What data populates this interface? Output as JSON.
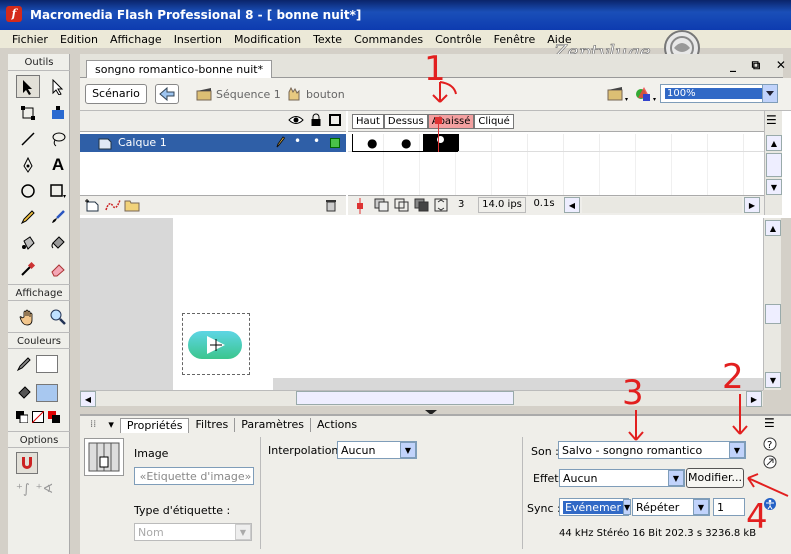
{
  "app": {
    "title": "Macromedia Flash Professional 8 - [ bonne nuit*]",
    "icon_letter": "f"
  },
  "menu": [
    "Fichier",
    "Edition",
    "Affichage",
    "Insertion",
    "Modification",
    "Texte",
    "Commandes",
    "Contrôle",
    "Fenêtre",
    "Aide"
  ],
  "watermark": {
    "text": "Zeptyluge"
  },
  "tools": {
    "outils_label": "Outils",
    "affichage_label": "Affichage",
    "couleurs_label": "Couleurs",
    "options_label": "Options",
    "text_tool_glyph": "A"
  },
  "document": {
    "tab_label": "songno romantico-bonne nuit*",
    "scene_button": "Scénario",
    "breadcrumb_scene": "Séquence 1",
    "breadcrumb_symbol": "bouton",
    "zoom": "100%",
    "window_buttons": [
      "_",
      "⧉",
      "✕"
    ]
  },
  "timeline": {
    "layer_name": "Calque 1",
    "frame_labels": [
      "Haut",
      "Dessus",
      "Abaissé",
      "Cliqué"
    ],
    "selected_frame_label": "Abaissé",
    "current_frame": "3",
    "frame_rate": "14.0 ips",
    "elapsed_time": "0.1s"
  },
  "properties": {
    "tabs": [
      "Propriétés",
      "Filtres",
      "Paramètres",
      "Actions"
    ],
    "active_tab": "Propriétés",
    "type_label": "Image",
    "frame_label_placeholder": "«Etiquette d'image»",
    "label_type_label": "Type d'étiquette :",
    "label_type_value": "Nom",
    "interpolation_label": "Interpolation:",
    "interpolation_value": "Aucun",
    "sound_label": "Son :",
    "sound_value": "Salvo - songno romantico",
    "effect_label": "Effet",
    "effect_value": "Aucun",
    "modify_button": "Modifier...",
    "sync_label": "Sync :",
    "sync_value": "Evénemer",
    "repeat_value": "Répéter",
    "repeat_count": "1",
    "sound_info": "44 kHz Stéréo 16 Bit 202.3 s 3236.8 kB"
  },
  "annotations": [
    "1",
    "2",
    "3",
    "4"
  ],
  "colors": {
    "accent_red": "#e21f1f",
    "layer_selected": "#2f5fa7",
    "title_bar": "#0a246a"
  }
}
